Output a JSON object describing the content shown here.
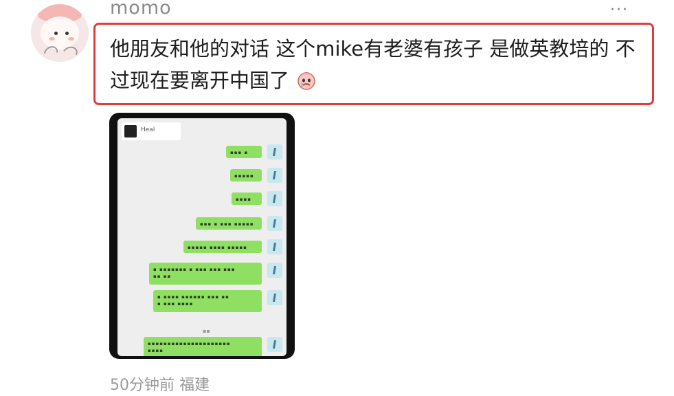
{
  "post": {
    "username": "momo",
    "more_glyph": "···",
    "text": "他朋友和他的对话 这个mike有老婆有孩子 是做英教培的 不过现在要离开中国了",
    "emoji_icon": "crying-face-emoji",
    "meta": "50分钟前 福建",
    "highlight_color": "#e23b3b"
  },
  "attachment": {
    "chat_header": "Heal",
    "bubble_color": "#8fe062"
  }
}
